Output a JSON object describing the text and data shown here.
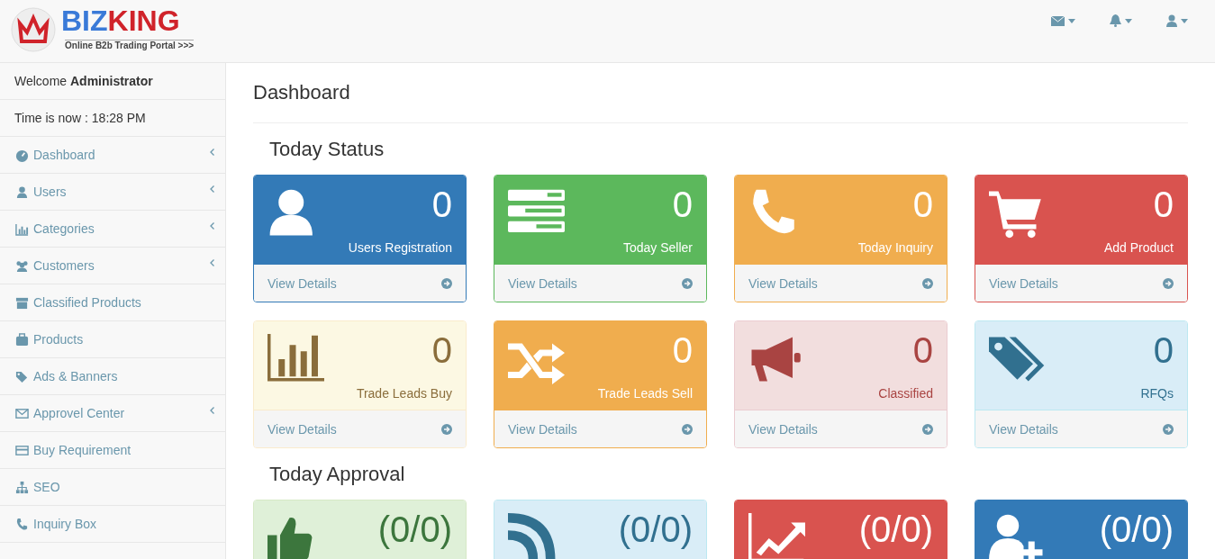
{
  "brand": {
    "name_part_1": "BIZ",
    "name_part_2": "KING",
    "tagline": "Online B2b Trading Portal >>>"
  },
  "sidebar": {
    "welcome": "Welcome **Administrator**",
    "time": "Time is now : 18:28 PM",
    "items": [
      {
        "label": "Dashboard",
        "kind": "dashboard",
        "expandable": true
      },
      {
        "label": "Users",
        "kind": "user",
        "expandable": true
      },
      {
        "label": "Categories",
        "kind": "chart",
        "expandable": true
      },
      {
        "label": "Customers",
        "kind": "users",
        "expandable": true
      },
      {
        "label": "Classified Products",
        "kind": "archive",
        "expandable": false
      },
      {
        "label": "Products",
        "kind": "briefcase",
        "expandable": false
      },
      {
        "label": "Ads & Banners",
        "kind": "tags",
        "expandable": false
      },
      {
        "label": "Approvel Center",
        "kind": "envelope",
        "expandable": true
      },
      {
        "label": "Buy Requirement",
        "kind": "card",
        "expandable": false
      },
      {
        "label": "SEO",
        "kind": "sitemap",
        "expandable": false
      },
      {
        "label": "Inquiry Box",
        "kind": "phone",
        "expandable": false
      }
    ]
  },
  "page_title": "Dashboard",
  "sections": [
    {
      "title": "Today Status",
      "panels": [
        {
          "value": "0",
          "label": "Users Registration",
          "link": "View Details",
          "kind": "user",
          "color": "#337ab7"
        },
        {
          "value": "0",
          "label": "Today Seller",
          "link": "View Details",
          "kind": "server",
          "color": "#5cb85c"
        },
        {
          "value": "0",
          "label": "Today Inquiry",
          "link": "View Details",
          "kind": "phone",
          "color": "#f0ad4e"
        },
        {
          "value": "0",
          "label": "Add Product",
          "link": "View Details",
          "kind": "cart",
          "color": "#d9534f"
        },
        {
          "value": "0",
          "label": "Trade Leads Buy",
          "link": "View Details",
          "kind": "barchart",
          "color": "#fcf8e3"
        },
        {
          "value": "0",
          "label": "Trade Leads Sell",
          "link": "View Details",
          "kind": "shuffle",
          "color": "#f0ad4e"
        },
        {
          "value": "0",
          "label": "Classified",
          "link": "View Details",
          "kind": "megaphone",
          "color": "#f2dede"
        },
        {
          "value": "0",
          "label": "RFQs",
          "link": "View Details",
          "kind": "tags",
          "color": "#d9edf7"
        }
      ]
    },
    {
      "title": "Today Approval",
      "panels": [
        {
          "value": "(0/0)",
          "kind": "thumb",
          "color": "#dff0d8"
        },
        {
          "value": "(0/0)",
          "kind": "rss",
          "color": "#d9edf7"
        },
        {
          "value": "(0/0)",
          "kind": "trend",
          "color": "#d9534f"
        },
        {
          "value": "(0/0)",
          "kind": "useradd",
          "color": "#337ab7"
        }
      ]
    }
  ]
}
